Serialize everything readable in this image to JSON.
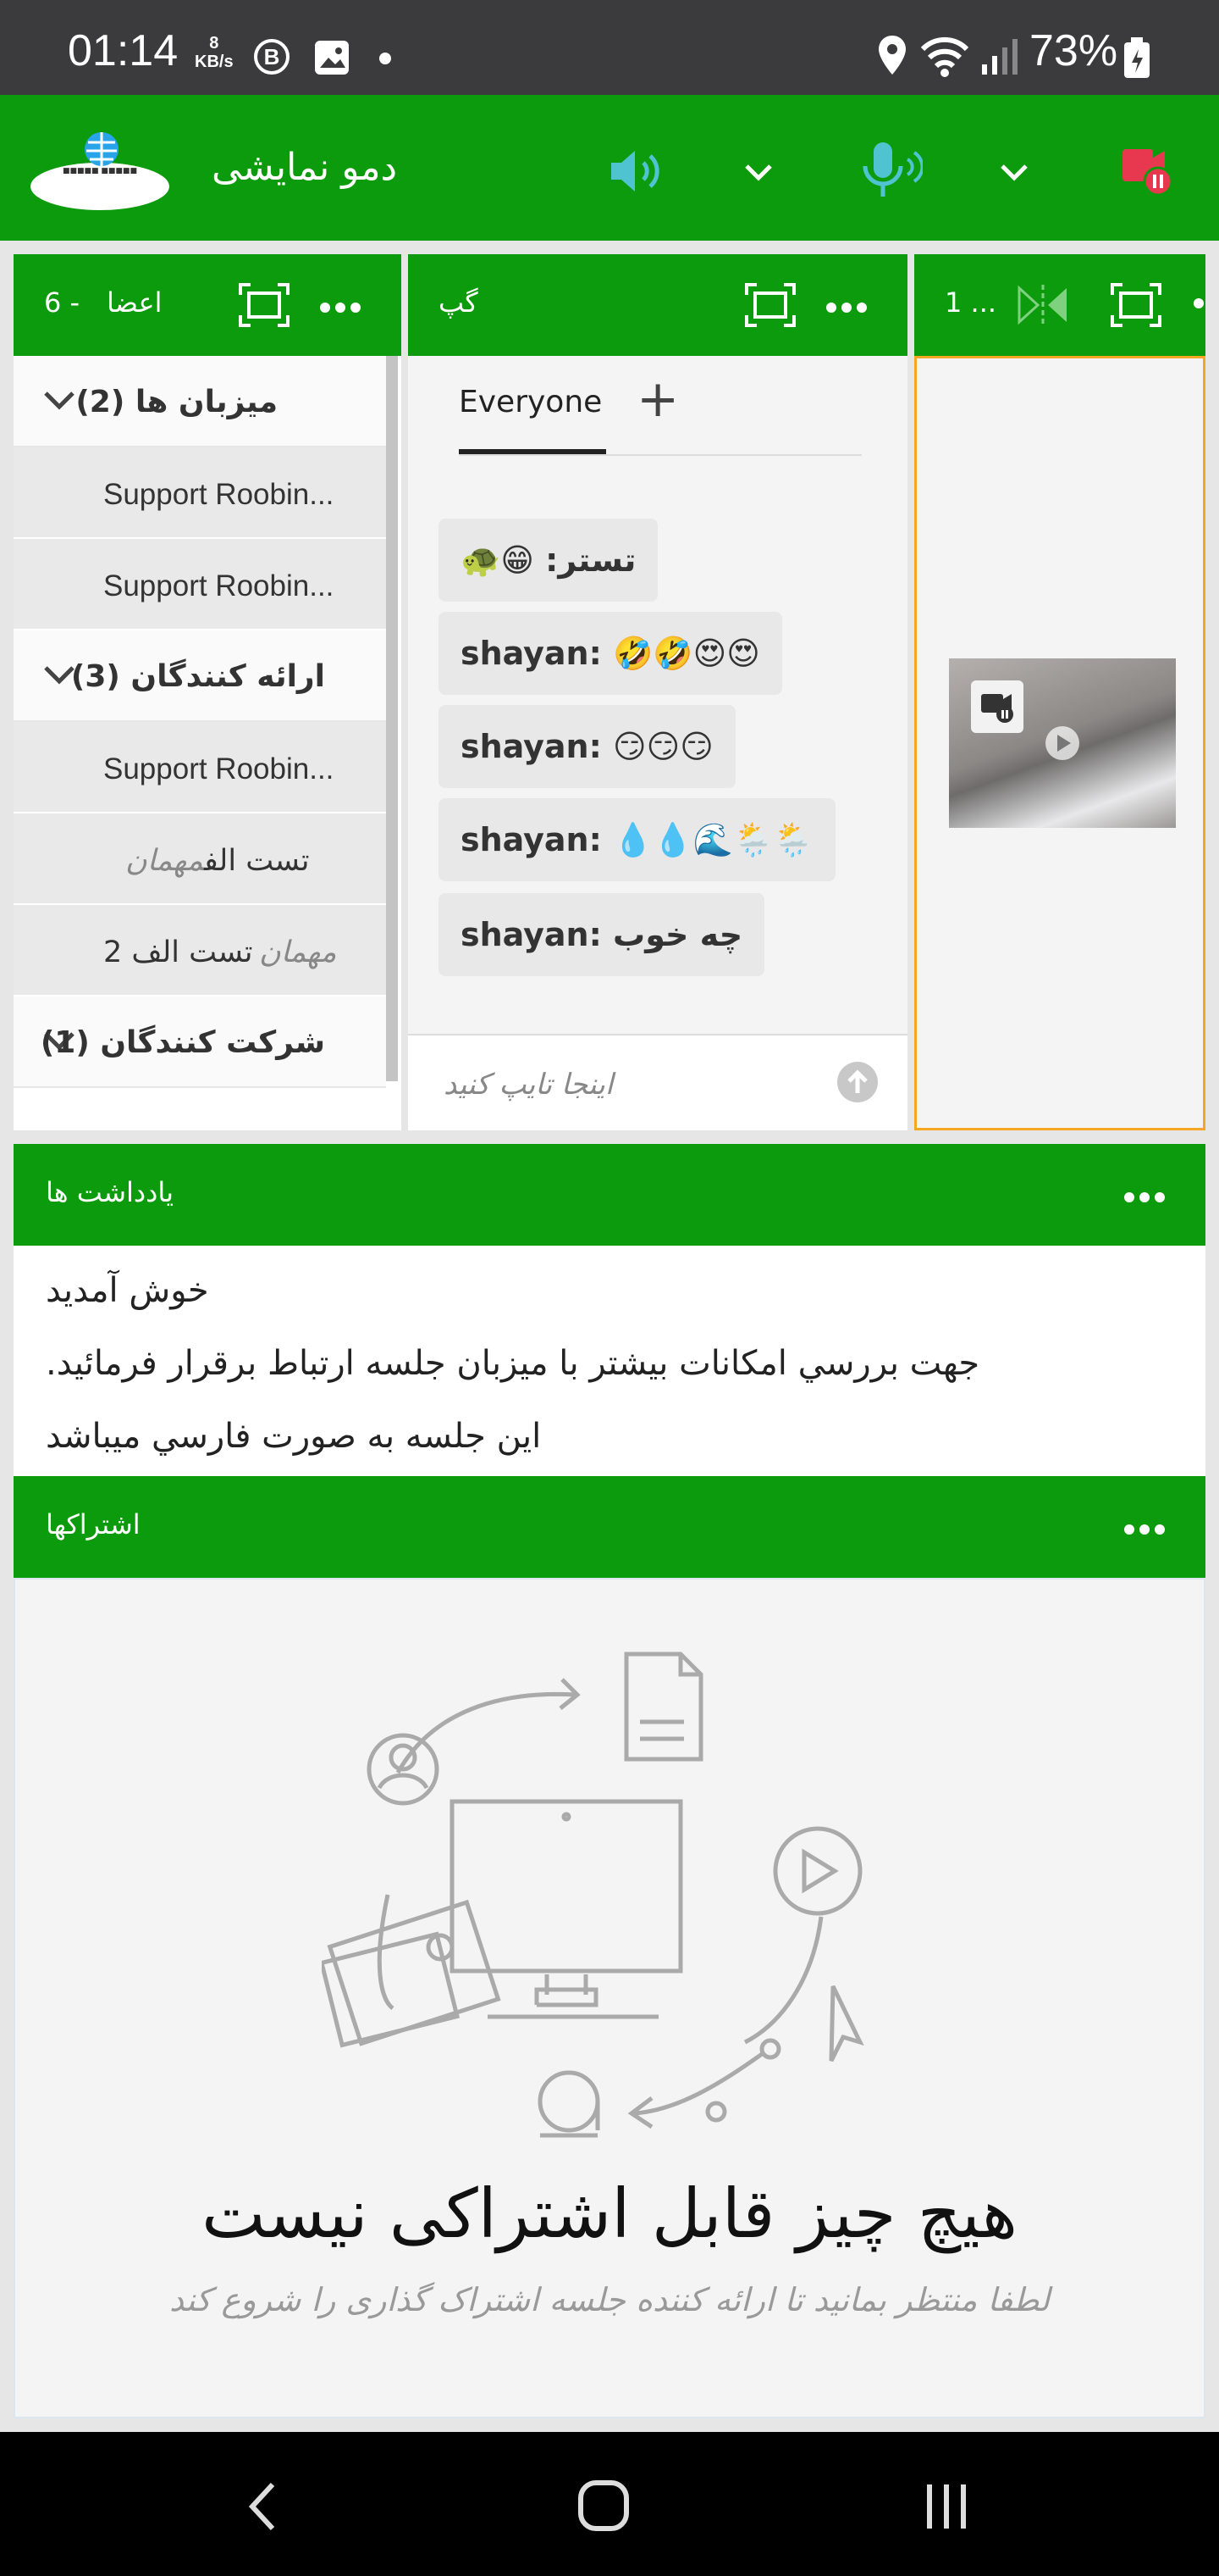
{
  "status_bar": {
    "time": "01:14",
    "net_speed_value": "8",
    "net_speed_unit": "KB/s",
    "b_badge": "B",
    "battery": "73%"
  },
  "app_bar": {
    "title": "دمو نمایشی",
    "logo_icon": "globe-logo-icon",
    "speaker_icon": "speaker-icon",
    "mic_icon": "microphone-icon",
    "record_icon": "record-pause-icon"
  },
  "attendees": {
    "title": "اعضا",
    "count": "6 -",
    "sections": [
      {
        "label": "میزبان ها (2)",
        "users": [
          "Support Roobin...",
          "Support Roobin..."
        ]
      },
      {
        "label": "ارائه کنندگان (3)",
        "users": [
          "Support Roobin..."
        ]
      },
      {
        "label": "شرکت کنندگان (1)"
      }
    ],
    "guests": [
      {
        "role": "مهمان",
        "name": "تست الف"
      },
      {
        "role": "مهمان",
        "name": "تست الف 2"
      }
    ]
  },
  "chat": {
    "title": "گپ",
    "tab": "Everyone",
    "add_tab": "+",
    "messages": [
      {
        "sender": "تستر:",
        "text": "😁🐢"
      },
      {
        "sender": "shayan:",
        "text": "🤣🤣😍😍"
      },
      {
        "sender": "shayan:",
        "text": "😏😏😏"
      },
      {
        "sender": "shayan:",
        "text": "💧💧🌊🌦️🌦️"
      },
      {
        "sender": "shayan:",
        "text": "چه خوب"
      }
    ],
    "input_placeholder": "اینجا تایپ کنید"
  },
  "video": {
    "title": "1 ...",
    "mirror_icon": "mirror-icon",
    "fullscreen_icon": "fullscreen-icon"
  },
  "notes": {
    "title": "یادداشت ها",
    "lines": [
      "خوش آمديد",
      "جهت بررسي امکانات بيشتر با ميزبان جلسه ارتباط برقرار فرمائيد.",
      "اين جلسه به صورت فارسي ميباشد"
    ]
  },
  "share": {
    "title": "اشتراکها",
    "empty_title": "هیچ چیز قابل اشتراکی نیست",
    "empty_subtitle": "لطفا منتظر بمانید تا ارائه کننده جلسه اشتراک گذاری را شروع کند"
  },
  "colors": {
    "header_green": "#0c9b0c",
    "video_border": "#f5a623",
    "record_red": "#e8384f"
  }
}
